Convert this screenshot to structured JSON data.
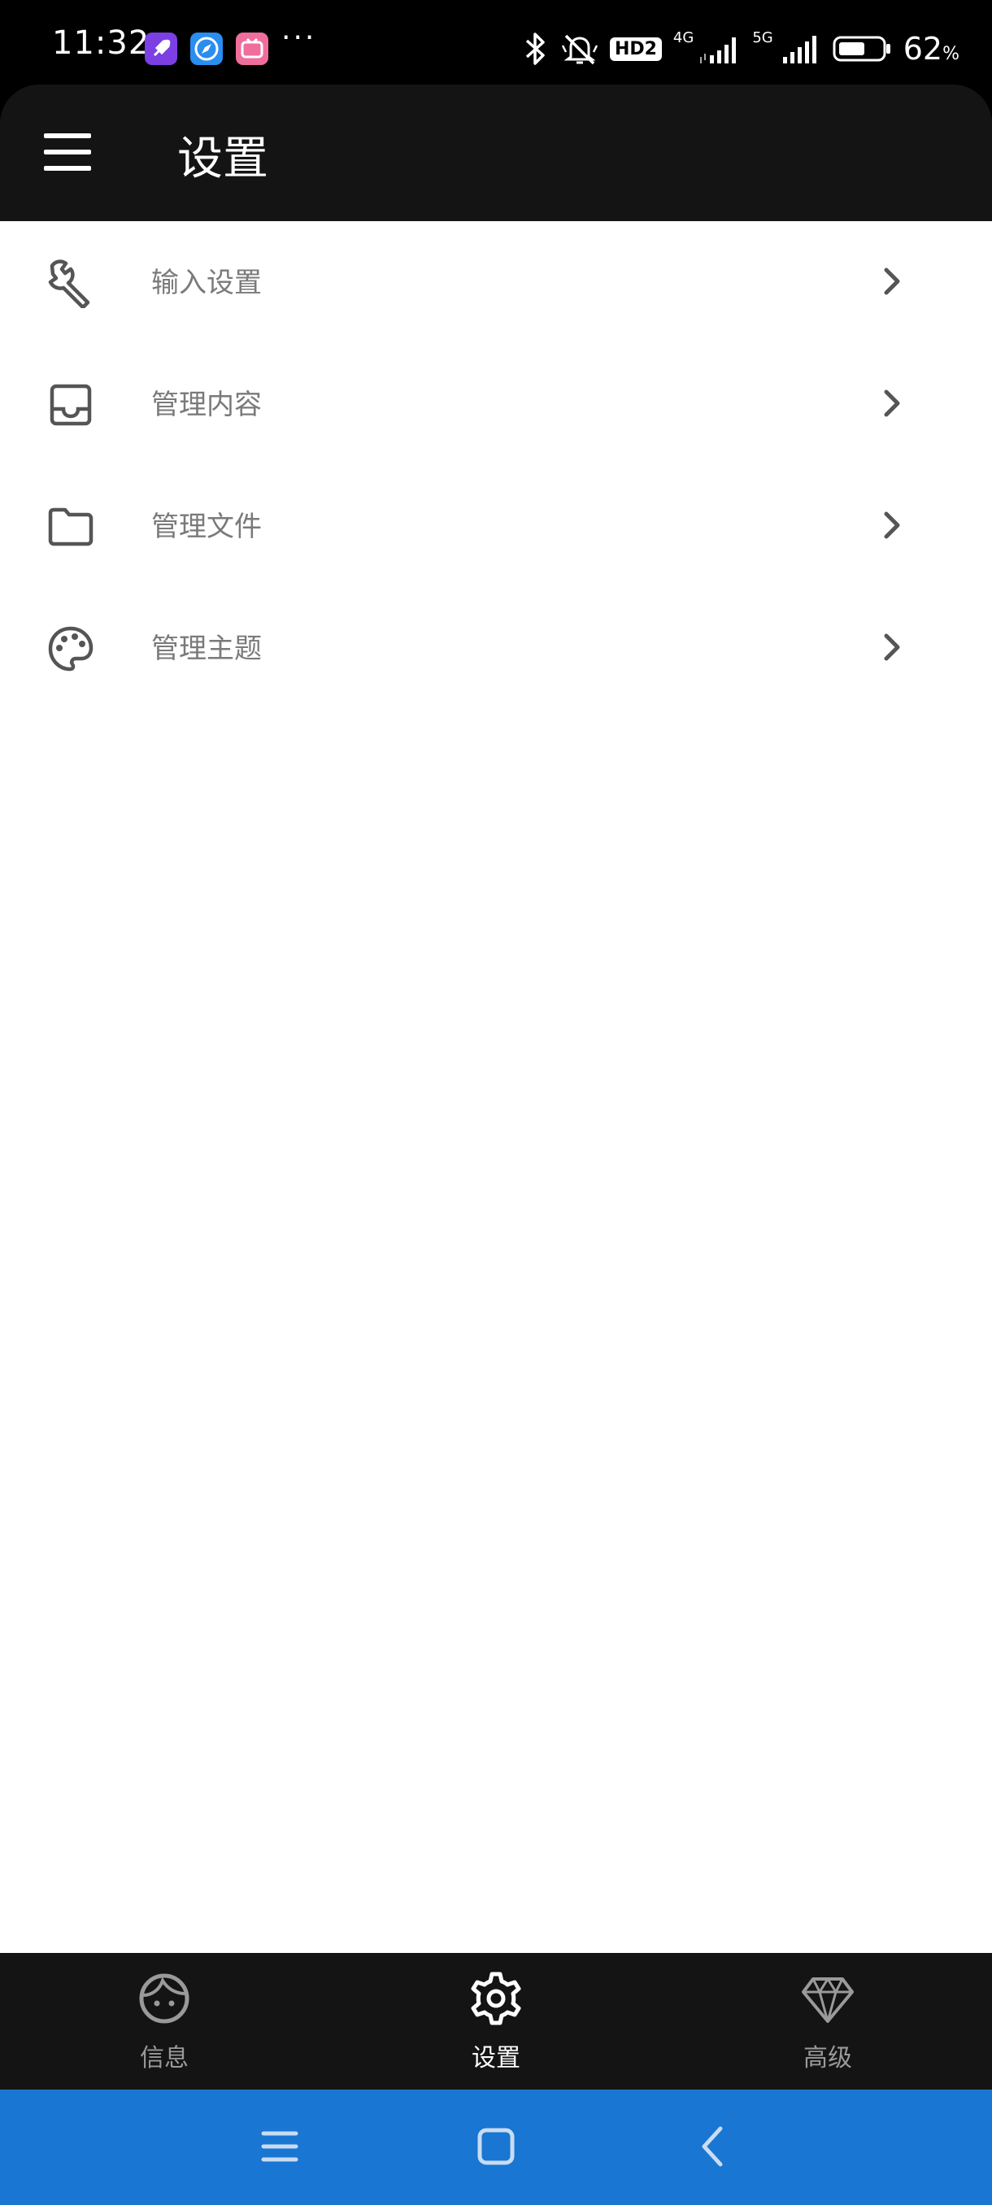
{
  "status_bar": {
    "time": "11:32",
    "more_dots": "···",
    "hd_badge": "HD2",
    "sim1_label": "4G",
    "sim2_label": "5G",
    "battery_percent": "62",
    "battery_unit": "%",
    "battery_level": 0.62,
    "app_icons": [
      {
        "name": "rocket-app-icon",
        "color": "#7b3fe4"
      },
      {
        "name": "compass-app-icon",
        "color": "#2a8df0"
      },
      {
        "name": "tv-app-icon",
        "color": "#f06e9c"
      }
    ]
  },
  "header": {
    "title": "设置",
    "menu_icon": "hamburger-icon"
  },
  "settings": {
    "items": [
      {
        "label": "输入设置",
        "icon": "wrench-icon"
      },
      {
        "label": "管理内容",
        "icon": "inbox-icon"
      },
      {
        "label": "管理文件",
        "icon": "folder-icon"
      },
      {
        "label": "管理主题",
        "icon": "palette-icon"
      }
    ]
  },
  "bottom_nav": {
    "items": [
      {
        "label": "信息",
        "icon": "face-icon",
        "active": false
      },
      {
        "label": "设置",
        "icon": "gear-icon",
        "active": true
      },
      {
        "label": "高级",
        "icon": "diamond-icon",
        "active": false
      }
    ],
    "active_color": "#ffffff",
    "inactive_color": "#9a9a9a"
  },
  "system_nav": {
    "buttons": [
      "menu-icon",
      "home-icon",
      "back-icon"
    ],
    "background": "#1976d2"
  }
}
